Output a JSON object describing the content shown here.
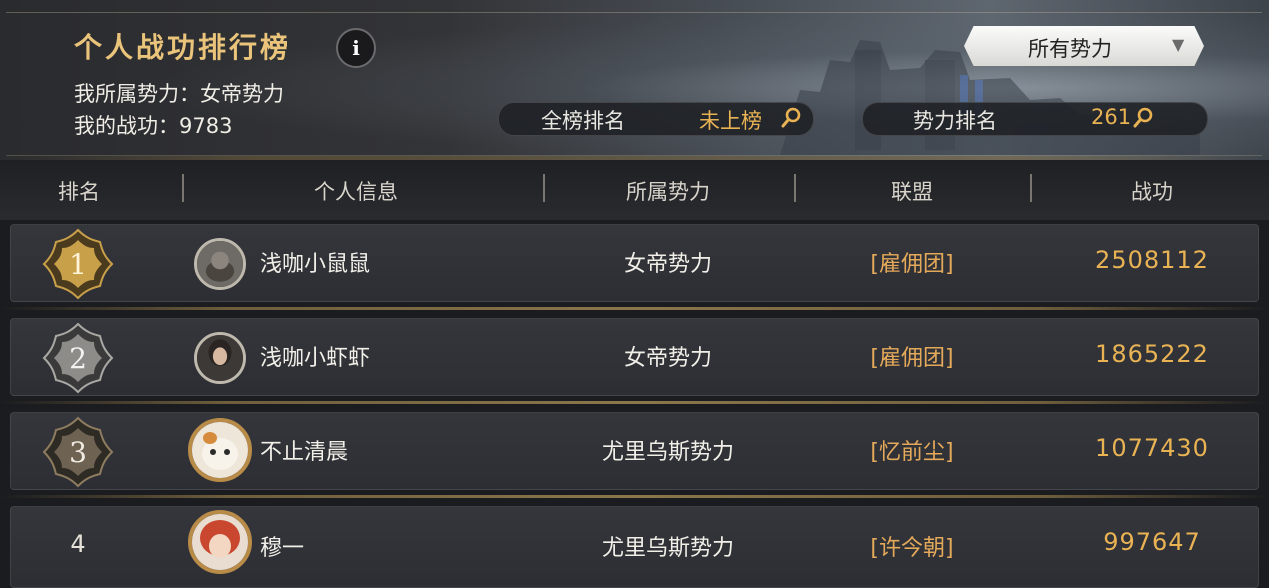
{
  "header": {
    "title": "个人战功排行榜",
    "info_icon": "info-icon",
    "faction_line": "我所属势力：女帝势力",
    "merit_line": "我的战功：9783",
    "filter_dropdown": {
      "selected": "所有势力",
      "icon": "triangle-down-icon"
    },
    "overall_rank": {
      "label": "全榜排名",
      "value": "未上榜",
      "icon": "magnifier-icon"
    },
    "faction_rank": {
      "label": "势力排名",
      "value": "261",
      "icon": "magnifier-icon"
    }
  },
  "columns": [
    "排名",
    "个人信息",
    "所属势力",
    "联盟",
    "战功"
  ],
  "rows": [
    {
      "rank": "1",
      "name": "浅咖小鼠鼠",
      "faction": "女帝势力",
      "alliance": "[雇佣团]",
      "merit": "2508112",
      "badge": "gold"
    },
    {
      "rank": "2",
      "name": "浅咖小虾虾",
      "faction": "女帝势力",
      "alliance": "[雇佣团]",
      "merit": "1865222",
      "badge": "silver"
    },
    {
      "rank": "3",
      "name": "不止清晨",
      "faction": "尤里乌斯势力",
      "alliance": "[忆前尘]",
      "merit": "1077430",
      "badge": "bronze"
    },
    {
      "rank": "4",
      "name": "穆一",
      "faction": "尤里乌斯势力",
      "alliance": "[许今朝]",
      "merit": "997647",
      "badge": "none"
    }
  ],
  "colors": {
    "gold_text": "#e9b354",
    "alliance_text": "#e5a95a",
    "badge_gold": "#c9a04a",
    "badge_silver": "#8d8c89",
    "badge_bronze": "#6e6253"
  }
}
